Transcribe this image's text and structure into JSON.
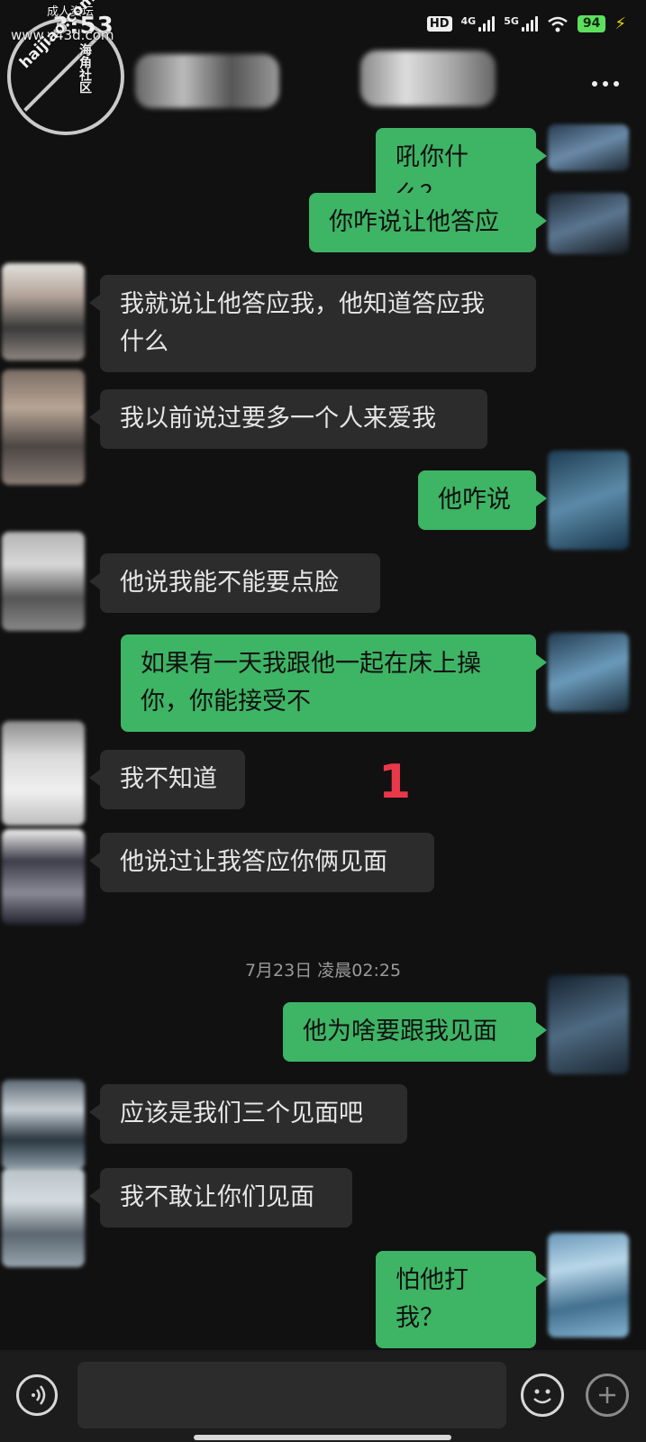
{
  "status_bar": {
    "time": "3:53",
    "hd": "HD",
    "network_1": "4G",
    "network_2": "5G",
    "battery": "94"
  },
  "watermark": {
    "site": "www.y43d.com",
    "title": "成人资坛",
    "brand": "海角社区",
    "domain": "haijiao.com"
  },
  "annotation": "1",
  "time_divider": "7月23日 凌晨02:25",
  "messages": [
    {
      "side": "out",
      "text": "吼你什么？"
    },
    {
      "side": "out",
      "text": "你咋说让他答应"
    },
    {
      "side": "in",
      "text": "我就说让他答应我，他知道答应我\n什么"
    },
    {
      "side": "in",
      "text": "我以前说过要多一个人来爱我"
    },
    {
      "side": "out",
      "text": "他咋说"
    },
    {
      "side": "in",
      "text": "他说我能不能要点脸"
    },
    {
      "side": "out",
      "text": "如果有一天我跟他一起在床上操\n你，你能接受不"
    },
    {
      "side": "in",
      "text": "我不知道"
    },
    {
      "side": "in",
      "text": "他说过让我答应你俩见面"
    },
    {
      "side": "out",
      "text": "他为啥要跟我见面"
    },
    {
      "side": "in",
      "text": "应该是我们三个见面吧"
    },
    {
      "side": "in",
      "text": "我不敢让你们见面"
    },
    {
      "side": "out",
      "text": "怕他打我？"
    }
  ],
  "icons": {
    "voice": "voice-icon",
    "emoji": "emoji-icon",
    "plus": "plus-icon",
    "more": "more-icon"
  },
  "colors": {
    "background": "#111111",
    "incoming_bubble": "#2c2c2c",
    "outgoing_bubble": "#3eb465",
    "annotation": "#e8384a"
  }
}
